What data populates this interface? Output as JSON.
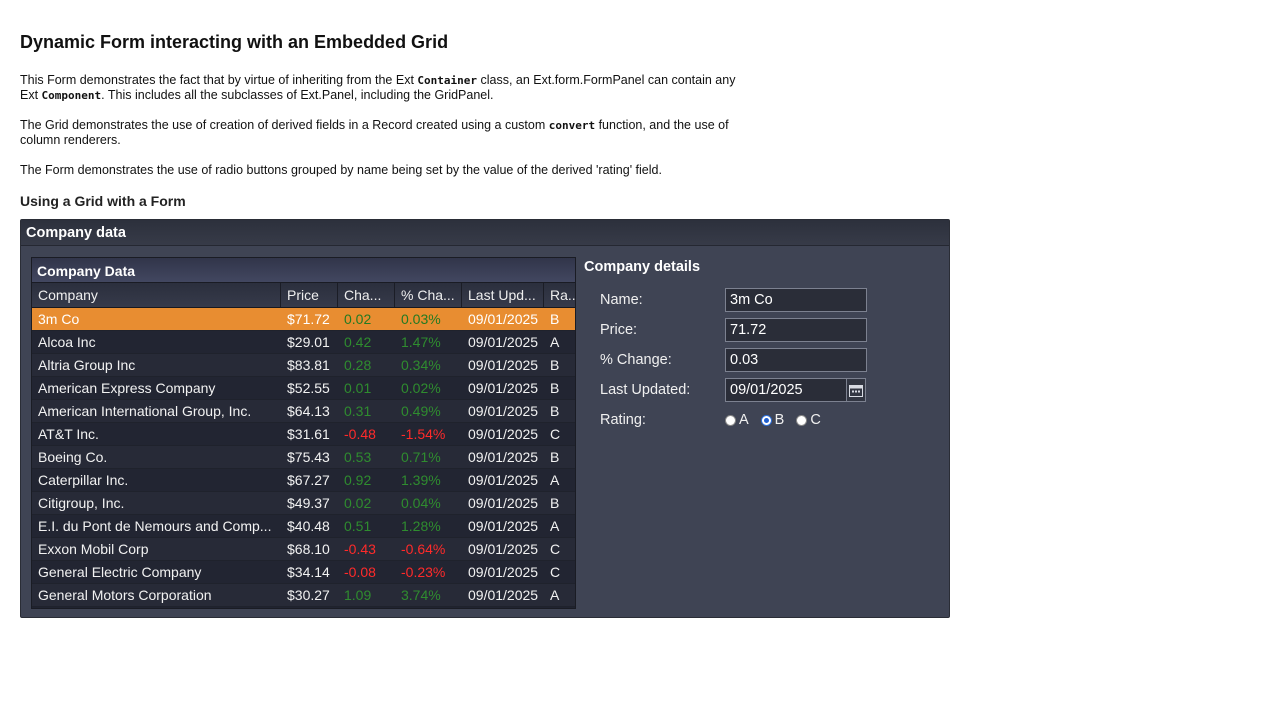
{
  "page": {
    "title": "Dynamic Form interacting with an Embedded Grid",
    "para1": {
      "t1": "This Form demonstrates the fact that by virtue of inheriting from the Ext ",
      "code1": "Container",
      "t2": " class, an Ext.form.FormPanel can contain any",
      "t3": "Ext ",
      "code2": "Component",
      "t4": ". This includes all the subclasses of Ext.Panel, including the GridPanel."
    },
    "para2": {
      "t1": "The Grid demonstrates the use of creation of derived fields in a Record created using a custom ",
      "code1": "convert",
      "t2": " function, and the use of",
      "t3": "column renderers."
    },
    "para3": "The Form demonstrates the use of radio buttons grouped by name being set by the value of the derived 'rating' field.",
    "subheading": "Using a Grid with a Form"
  },
  "panel": {
    "title": "Company data",
    "grid": {
      "title": "Company Data",
      "columns": [
        "Company",
        "Price",
        "Cha...",
        "% Cha...",
        "Last Upd...",
        "Ra..."
      ],
      "rows": [
        {
          "company": "3m Co",
          "price": "$71.72",
          "change": "0.02",
          "pct": "0.03%",
          "date": "09/01/2025",
          "rating": "B",
          "dir": "pos",
          "selected": true
        },
        {
          "company": "Alcoa Inc",
          "price": "$29.01",
          "change": "0.42",
          "pct": "1.47%",
          "date": "09/01/2025",
          "rating": "A",
          "dir": "pos"
        },
        {
          "company": "Altria Group Inc",
          "price": "$83.81",
          "change": "0.28",
          "pct": "0.34%",
          "date": "09/01/2025",
          "rating": "B",
          "dir": "pos"
        },
        {
          "company": "American Express Company",
          "price": "$52.55",
          "change": "0.01",
          "pct": "0.02%",
          "date": "09/01/2025",
          "rating": "B",
          "dir": "pos"
        },
        {
          "company": "American International Group, Inc.",
          "price": "$64.13",
          "change": "0.31",
          "pct": "0.49%",
          "date": "09/01/2025",
          "rating": "B",
          "dir": "pos"
        },
        {
          "company": "AT&T Inc.",
          "price": "$31.61",
          "change": "-0.48",
          "pct": "-1.54%",
          "date": "09/01/2025",
          "rating": "C",
          "dir": "neg"
        },
        {
          "company": "Boeing Co.",
          "price": "$75.43",
          "change": "0.53",
          "pct": "0.71%",
          "date": "09/01/2025",
          "rating": "B",
          "dir": "pos"
        },
        {
          "company": "Caterpillar Inc.",
          "price": "$67.27",
          "change": "0.92",
          "pct": "1.39%",
          "date": "09/01/2025",
          "rating": "A",
          "dir": "pos"
        },
        {
          "company": "Citigroup, Inc.",
          "price": "$49.37",
          "change": "0.02",
          "pct": "0.04%",
          "date": "09/01/2025",
          "rating": "B",
          "dir": "pos"
        },
        {
          "company": "E.I. du Pont de Nemours and Comp...",
          "price": "$40.48",
          "change": "0.51",
          "pct": "1.28%",
          "date": "09/01/2025",
          "rating": "A",
          "dir": "pos"
        },
        {
          "company": "Exxon Mobil Corp",
          "price": "$68.10",
          "change": "-0.43",
          "pct": "-0.64%",
          "date": "09/01/2025",
          "rating": "C",
          "dir": "neg"
        },
        {
          "company": "General Electric Company",
          "price": "$34.14",
          "change": "-0.08",
          "pct": "-0.23%",
          "date": "09/01/2025",
          "rating": "C",
          "dir": "neg"
        },
        {
          "company": "General Motors Corporation",
          "price": "$30.27",
          "change": "1.09",
          "pct": "3.74%",
          "date": "09/01/2025",
          "rating": "A",
          "dir": "pos"
        }
      ]
    },
    "details": {
      "title": "Company details",
      "name_label": "Name:",
      "name_value": "3m Co",
      "price_label": "Price:",
      "price_value": "71.72",
      "pct_label": "% Change:",
      "pct_value": "0.03",
      "date_label": "Last Updated:",
      "date_value": "09/01/2025",
      "rating_label": "Rating:",
      "rating_options": [
        "A",
        "B",
        "C"
      ],
      "rating_selected": "B"
    }
  },
  "colors": {
    "selected_row": "#e88d31",
    "positive": "#2f8c2f",
    "negative": "#ff2a2a",
    "panel_bg": "#3f4454"
  },
  "icons": {
    "date_trigger": "calendar-icon"
  }
}
